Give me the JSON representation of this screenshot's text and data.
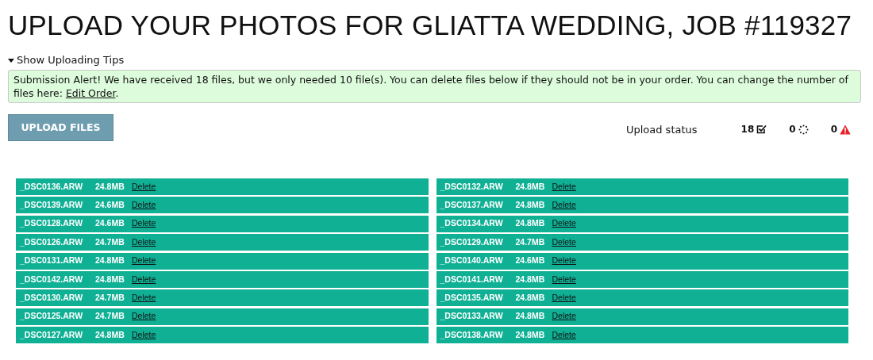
{
  "title": "UPLOAD YOUR PHOTOS FOR GLIATTA WEDDING, JOB #119327",
  "tips_toggle": {
    "label": "Show Uploading Tips",
    "expanded": false
  },
  "alert": {
    "text": "Submission Alert! We have received 18 files, but we only needed 10 file(s). You can delete files below if they should not be in your order. You can change the number of files here: ",
    "link": "Edit Order",
    "after": "."
  },
  "upload_button": "UPLOAD FILES",
  "upload_status": {
    "label": "Upload status",
    "counts": [
      {
        "kind": "done",
        "value": "18"
      },
      {
        "kind": "pending",
        "value": "0"
      },
      {
        "kind": "error",
        "value": "0"
      }
    ]
  },
  "file_columns": [
    [
      {
        "name": "_DSC0136.ARW",
        "size": "24.8MB",
        "action": "Delete"
      },
      {
        "name": "_DSC0139.ARW",
        "size": "24.6MB",
        "action": "Delete"
      },
      {
        "name": "_DSC0128.ARW",
        "size": "24.6MB",
        "action": "Delete"
      },
      {
        "name": "_DSC0126.ARW",
        "size": "24.7MB",
        "action": "Delete"
      },
      {
        "name": "_DSC0131.ARW",
        "size": "24.8MB",
        "action": "Delete"
      },
      {
        "name": "_DSC0142.ARW",
        "size": "24.8MB",
        "action": "Delete"
      },
      {
        "name": "_DSC0130.ARW",
        "size": "24.7MB",
        "action": "Delete"
      },
      {
        "name": "_DSC0125.ARW",
        "size": "24.7MB",
        "action": "Delete"
      },
      {
        "name": "_DSC0127.ARW",
        "size": "24.8MB",
        "action": "Delete"
      }
    ],
    [
      {
        "name": "_DSC0132.ARW",
        "size": "24.8MB",
        "action": "Delete"
      },
      {
        "name": "_DSC0137.ARW",
        "size": "24.8MB",
        "action": "Delete"
      },
      {
        "name": "_DSC0134.ARW",
        "size": "24.8MB",
        "action": "Delete"
      },
      {
        "name": "_DSC0129.ARW",
        "size": "24.7MB",
        "action": "Delete"
      },
      {
        "name": "_DSC0140.ARW",
        "size": "24.6MB",
        "action": "Delete"
      },
      {
        "name": "_DSC0141.ARW",
        "size": "24.8MB",
        "action": "Delete"
      },
      {
        "name": "_DSC0135.ARW",
        "size": "24.8MB",
        "action": "Delete"
      },
      {
        "name": "_DSC0133.ARW",
        "size": "24.8MB",
        "action": "Delete"
      },
      {
        "name": "_DSC0138.ARW",
        "size": "24.8MB",
        "action": "Delete"
      }
    ]
  ]
}
